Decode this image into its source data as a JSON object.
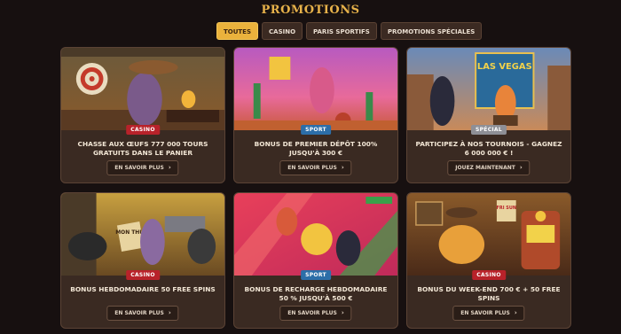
{
  "header": {
    "title": "PROMOTIONS"
  },
  "tabs": [
    {
      "label": "TOUTES",
      "active": true
    },
    {
      "label": "CASINO",
      "active": false
    },
    {
      "label": "PARIS SPORTIFS",
      "active": false
    },
    {
      "label": "PROMOTIONS SPÉCIALES",
      "active": false
    }
  ],
  "cards": [
    {
      "badge": "CASINO",
      "badge_type": "casino",
      "title": "CHASSE AUX ŒUFS 777 000 TOURS GRATUITS DANS LE PANIER",
      "button": "EN SAVOIR PLUS",
      "icon": "chevron-right-icon"
    },
    {
      "badge": "SPORT",
      "badge_type": "sport",
      "title": "BONUS DE PREMIER DÉPÔT 100% JUSQU'À 300 €",
      "button": "EN SAVOIR PLUS",
      "icon": "chevron-right-icon"
    },
    {
      "badge": "SPÉCIAL",
      "badge_type": "special",
      "title": "PARTICIPEZ À NOS TOURNOIS - GAGNEZ 6 000 000 € !",
      "button": "JOUEZ MAINTENANT",
      "icon": "chevron-right-icon"
    },
    {
      "badge": "CASINO",
      "badge_type": "casino",
      "title": "BONUS HEBDOMADAIRE 50 FREE SPINS",
      "button": "EN SAVOIR PLUS",
      "icon": "chevron-right-icon"
    },
    {
      "badge": "SPORT",
      "badge_type": "sport",
      "title": "BONUS DE RECHARGE HEBDOMADAIRE 50 % JUSQU'À 500 €",
      "button": "EN SAVOIR PLUS",
      "icon": "chevron-right-icon"
    },
    {
      "badge": "CASINO",
      "badge_type": "casino",
      "title": "BONUS DU WEEK-END 700 € + 50 FREE SPINS",
      "button": "EN SAVOIR PLUS",
      "icon": "chevron-right-icon"
    }
  ],
  "art_text": {
    "vegas_sign": "LAS VEGAS",
    "card4_sign": "MON THU",
    "card6_sign": "FRI SUN"
  },
  "colors": {
    "background": "#171010",
    "accent": "#eab23c",
    "card": "#3a2a22",
    "casino_badge": "#b8222a",
    "sport_badge": "#2c6ea8",
    "special_badge": "#8e8f96"
  }
}
